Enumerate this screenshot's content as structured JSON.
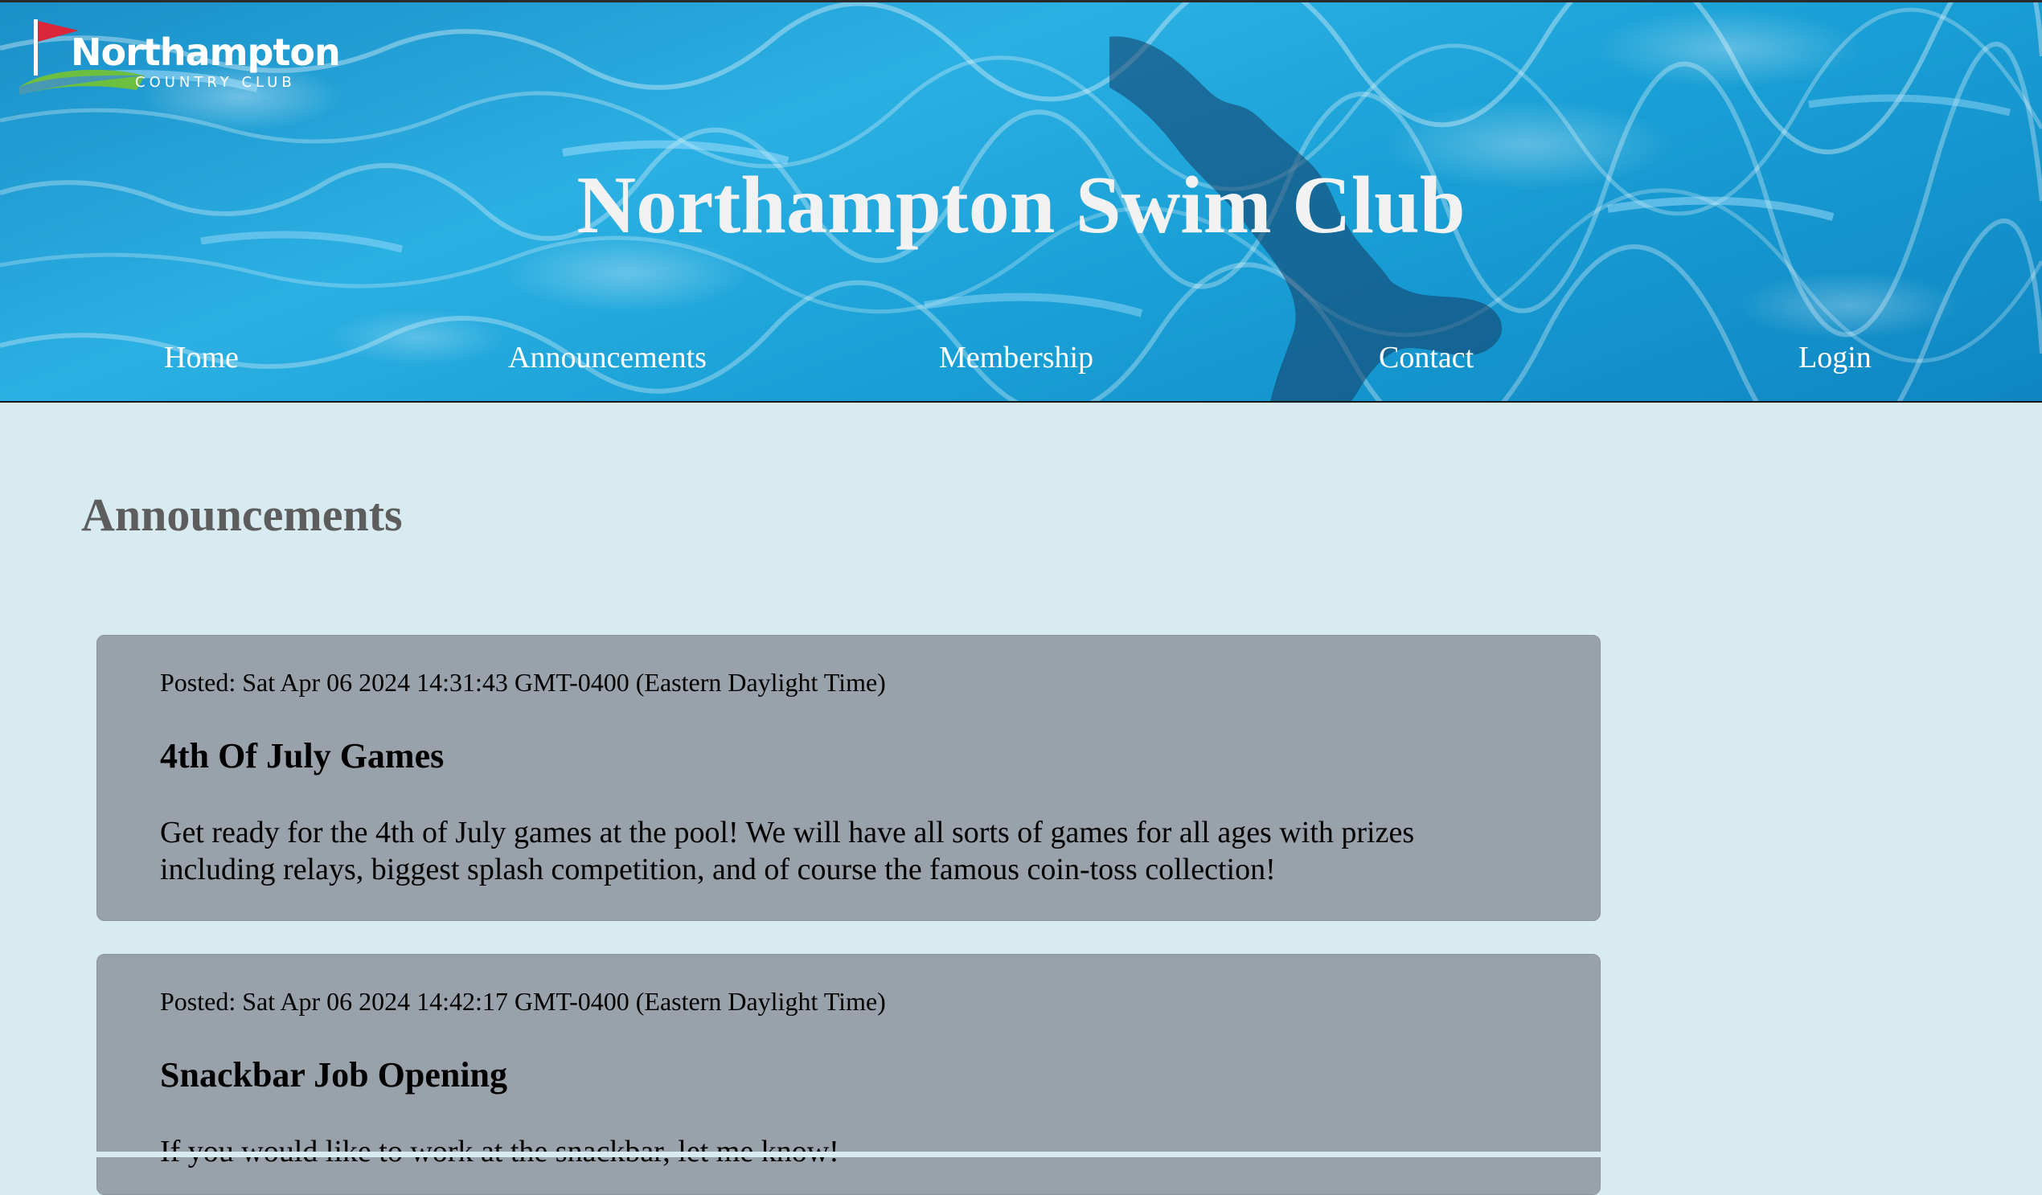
{
  "logo": {
    "name": "Northampton",
    "subtitle": "COUNTRY CLUB"
  },
  "header": {
    "title": "Northampton Swim Club"
  },
  "nav": {
    "items": [
      {
        "label": "Home"
      },
      {
        "label": "Announcements"
      },
      {
        "label": "Membership"
      },
      {
        "label": "Contact"
      },
      {
        "label": "Login"
      }
    ]
  },
  "main": {
    "heading": "Announcements",
    "announcements": [
      {
        "posted": "Posted: Sat Apr 06 2024 14:31:43 GMT-0400 (Eastern Daylight Time)",
        "title": "4th Of July Games",
        "body": "Get ready for the 4th of July games at the pool! We will have all sorts of games for all ages with prizes including relays, biggest splash competition, and of course the famous coin-toss collection!"
      },
      {
        "posted": "Posted: Sat Apr 06 2024 14:42:17 GMT-0400 (Eastern Daylight Time)",
        "title": "Snackbar Job Opening",
        "body": "If you would like to work at the snackbar, let me know!"
      }
    ]
  },
  "colors": {
    "page_background": "#d7ebf1",
    "card_background": "#99a1ab",
    "heading_text": "#5d5d5d",
    "water_blue": "#1fa3db"
  },
  "icons": {
    "logo_mark": "golf-flag-icon"
  }
}
